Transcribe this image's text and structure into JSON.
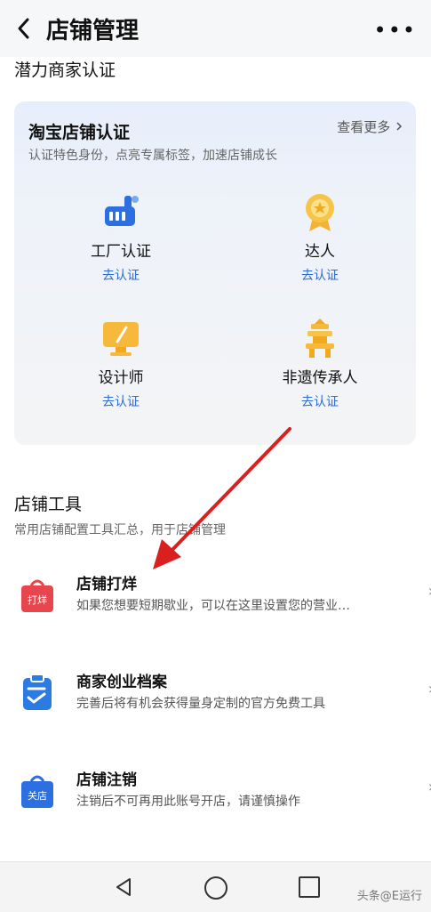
{
  "header": {
    "back_icon": "chevron-left-icon",
    "title": "店铺管理",
    "more_icon": "more-dots-icon",
    "more_text": "•••"
  },
  "potential": {
    "section_title": "潜力商家认证",
    "card": {
      "title": "淘宝店铺认证",
      "subtitle": "认证特色身份，点亮专属标签，加速店铺成长",
      "more": "查看更多",
      "items": [
        {
          "name": "工厂认证",
          "action": "去认证",
          "icon": "factory-icon"
        },
        {
          "name": "达人",
          "action": "去认证",
          "icon": "medal-icon"
        },
        {
          "name": "设计师",
          "action": "去认证",
          "icon": "monitor-pen-icon"
        },
        {
          "name": "非遗传承人",
          "action": "去认证",
          "icon": "pagoda-icon"
        }
      ]
    }
  },
  "tools": {
    "section_title": "店铺工具",
    "subtitle": "常用店铺配置工具汇总，用于店铺管理",
    "items": [
      {
        "name": "店铺打烊",
        "desc": "如果您想要短期歇业，可以在这里设置您的营业…",
        "icon_text": "打烊",
        "icon": "shop-closed-bag-icon"
      },
      {
        "name": "商家创业档案",
        "desc": "完善后将有机会获得量身定制的官方免费工具",
        "icon": "clipboard-check-icon"
      },
      {
        "name": "店铺注销",
        "desc": "注销后不可再用此账号开店，请谨慎操作",
        "icon_text": "关店",
        "icon": "shop-close-bag-icon"
      }
    ]
  },
  "navbar": {
    "back": "nav-back-icon",
    "home": "nav-home-icon",
    "recent": "nav-recent-icon"
  },
  "watermark": "头条@E运行",
  "colors": {
    "accent_blue": "#2c6bd7",
    "arrow_red": "#d9201e",
    "red_icon": "#e8464f",
    "blue_icon": "#2b7be3"
  }
}
